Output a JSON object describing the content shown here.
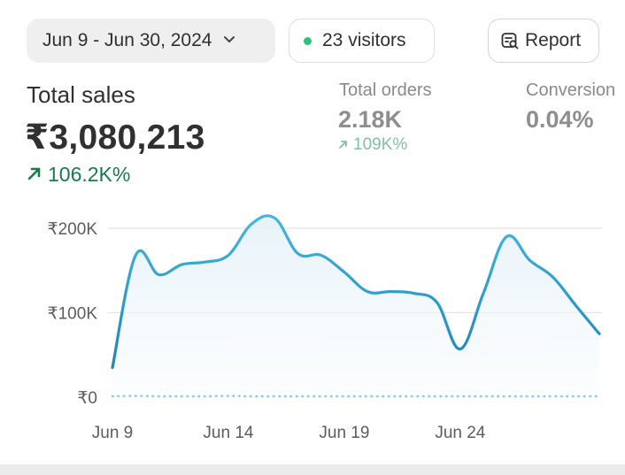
{
  "header": {
    "date_range": "Jun 9 - Jun 30, 2024",
    "visitors": "23 visitors",
    "report_label": "Report"
  },
  "metrics": {
    "total_sales": {
      "label": "Total sales",
      "value": "₹3,080,213",
      "change": "106.2K%"
    },
    "total_orders": {
      "label": "Total orders",
      "value": "2.18K",
      "change": "109K%"
    },
    "conversion": {
      "label": "Conversion",
      "value": "0.04%"
    }
  },
  "colors": {
    "line": "#3aa9cf",
    "compare_line": "#8fc8e8",
    "positive": "#1a7a4a",
    "visitor_dot": "#29c37a"
  },
  "chart_data": {
    "type": "line",
    "y_tick_labels": [
      "₹0",
      "₹100K",
      "₹200K"
    ],
    "y_ticks": [
      0,
      100000,
      200000
    ],
    "ylim": [
      0,
      200000
    ],
    "x_tick_labels": [
      "Jun 9",
      "Jun 14",
      "Jun 19",
      "Jun 24"
    ],
    "x_ticks": [
      9,
      14,
      19,
      24
    ],
    "xlim": [
      9,
      30
    ],
    "grid": true,
    "series": [
      {
        "role": "current",
        "x": [
          9,
          10,
          11,
          12,
          13,
          14,
          15,
          16,
          17,
          18,
          19,
          20,
          21,
          22,
          23,
          24,
          25,
          26,
          27,
          28,
          29,
          30
        ],
        "y": [
          35000,
          168000,
          145000,
          157000,
          160000,
          168000,
          205000,
          212000,
          170000,
          168000,
          148000,
          125000,
          125000,
          123000,
          112000,
          57000,
          123000,
          190000,
          162000,
          142000,
          108000,
          75000
        ]
      },
      {
        "role": "comparison",
        "style": "dotted",
        "x": [
          9,
          10,
          11,
          12,
          13,
          14,
          15,
          16,
          17,
          18,
          19,
          20,
          21,
          22,
          23,
          24,
          25,
          26,
          27,
          28,
          29,
          30
        ],
        "y": [
          1000,
          1500,
          1000,
          1000,
          1000,
          1500,
          1000,
          1000,
          1000,
          1000,
          1000,
          1000,
          1000,
          1000,
          1000,
          1000,
          1000,
          1000,
          1000,
          1000,
          1000,
          1000
        ]
      }
    ]
  }
}
